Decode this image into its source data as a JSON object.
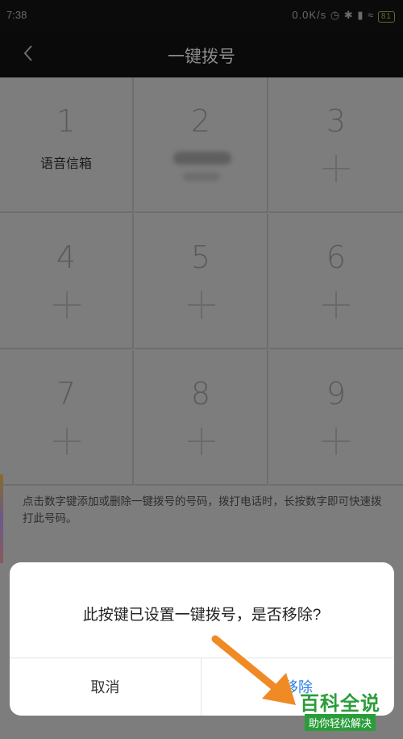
{
  "status_bar": {
    "time": "7:38",
    "indicators": "0.0K/s",
    "battery": "81"
  },
  "header": {
    "title": "一键拨号",
    "back_icon": "chevron-left-icon"
  },
  "keypad": {
    "keys": [
      {
        "digit": "1",
        "label": "语音信箱"
      },
      {
        "digit": "2"
      },
      {
        "digit": "3"
      },
      {
        "digit": "4"
      },
      {
        "digit": "5"
      },
      {
        "digit": "6"
      },
      {
        "digit": "7"
      },
      {
        "digit": "8"
      },
      {
        "digit": "9"
      }
    ],
    "add_icon": "plus-icon"
  },
  "hint": "点击数字键添加或删除一键拨号的号码，拨打电话时，长按数字即可快速拨打此号码。",
  "dialog": {
    "message": "此按键已设置一键拨号，是否移除?",
    "cancel_label": "取消",
    "remove_label": "移除"
  },
  "watermark": {
    "brand": "百科全说",
    "tagline": "助你轻松解决"
  },
  "colors": {
    "accent": "#2b7fe0",
    "arrow": "#f08a24",
    "watermark": "#2a9d3a"
  }
}
